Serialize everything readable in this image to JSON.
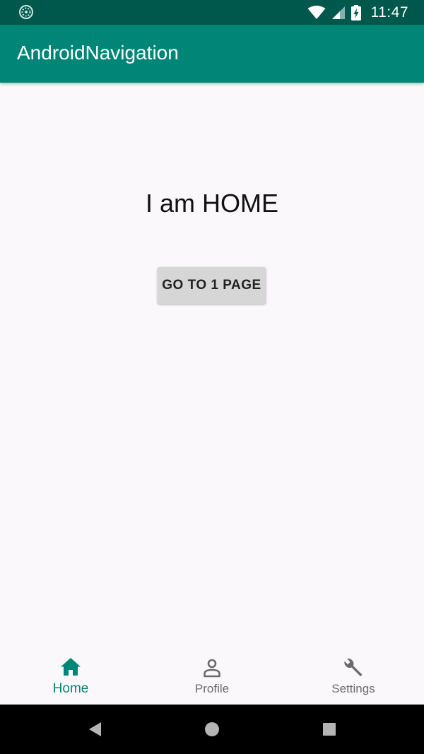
{
  "status_bar": {
    "time": "11:47",
    "icons": [
      "sync-spinner-icon",
      "wifi-icon",
      "cellular-signal-icon",
      "battery-charging-icon"
    ]
  },
  "app_bar": {
    "title": "AndroidNavigation"
  },
  "main": {
    "heading": "I am HOME",
    "button_label": "GO TO 1 PAGE"
  },
  "bottom_nav": {
    "items": [
      {
        "label": "Home",
        "icon": "home-icon",
        "active": true
      },
      {
        "label": "Profile",
        "icon": "person-icon",
        "active": false
      },
      {
        "label": "Settings",
        "icon": "wrench-icon",
        "active": false
      }
    ]
  },
  "system_nav": {
    "icons": [
      "back-triangle-icon",
      "home-circle-icon",
      "recents-square-icon"
    ]
  },
  "colors": {
    "status_bar": "#00574b",
    "app_bar": "#008577",
    "accent": "#008577",
    "inactive": "#6b6b6b",
    "background": "#faf8fb",
    "button": "#d6d6d6"
  }
}
